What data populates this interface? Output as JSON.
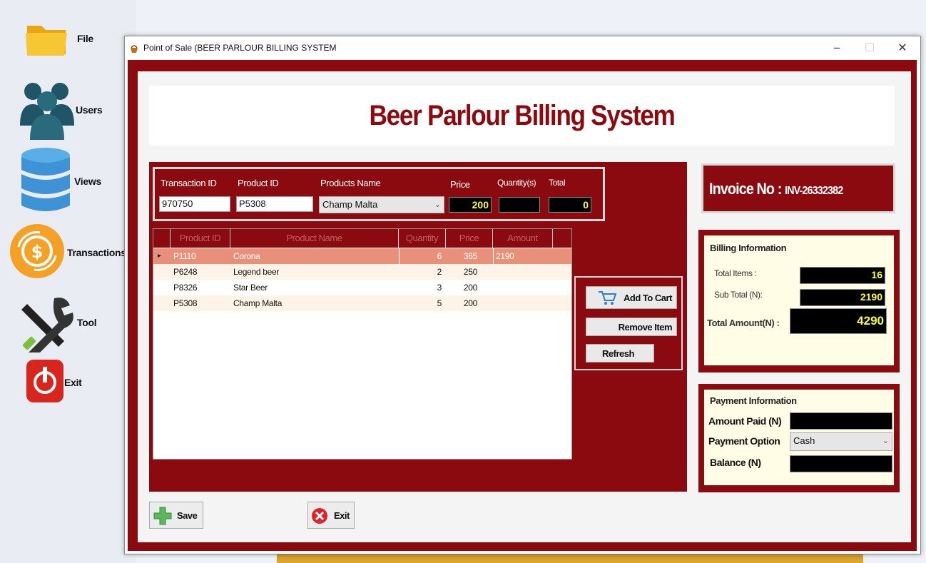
{
  "sidebar": {
    "items": [
      {
        "label": "File",
        "icon": "folder-icon"
      },
      {
        "label": "Users",
        "icon": "users-icon"
      },
      {
        "label": "Views",
        "icon": "database-icon"
      },
      {
        "label": "Transactions",
        "icon": "transactions-icon"
      },
      {
        "label": "Tool",
        "icon": "tools-icon"
      },
      {
        "label": "Exit",
        "icon": "power-icon"
      }
    ]
  },
  "window": {
    "title": "Point of Sale (BEER PARLOUR BILLING SYSTEM",
    "minimize": "‒",
    "maximize": "☐",
    "close": "✕"
  },
  "banner": {
    "title": "Beer Parlour Billing System"
  },
  "entry": {
    "transaction_id_label": "Transaction ID",
    "transaction_id_value": "970750",
    "product_id_label": "Product ID",
    "product_id_value": "P5308",
    "product_name_label": "Products Name",
    "product_name_value": "Champ Malta",
    "price_label": "Price",
    "price_value": "200",
    "quantity_label": "Quantity(s)",
    "quantity_value": "",
    "total_label": "Total",
    "total_value": "0"
  },
  "grid": {
    "columns": [
      "Product ID",
      "Product Name",
      "Quantity",
      "Price",
      "Amount"
    ],
    "rows": [
      {
        "selected": true,
        "product_id": "P1110",
        "product_name": "Corona",
        "quantity": "6",
        "price": "365",
        "amount": "2190"
      },
      {
        "selected": false,
        "product_id": "P6248",
        "product_name": "Legend beer",
        "quantity": "2",
        "price": "250",
        "amount": ""
      },
      {
        "selected": false,
        "product_id": "P8326",
        "product_name": "Star Beer",
        "quantity": "3",
        "price": "200",
        "amount": ""
      },
      {
        "selected": false,
        "product_id": "P5308",
        "product_name": "Champ Malta",
        "quantity": "5",
        "price": "200",
        "amount": ""
      }
    ],
    "row_marker": "▸"
  },
  "actions": {
    "add_to_cart": "Add To Cart",
    "remove_item": "Remove Item",
    "refresh": "Refresh"
  },
  "invoice": {
    "label": "Invoice No :",
    "number": "INV-26332382"
  },
  "billing": {
    "title": "Billing Information",
    "total_items_label": "Total Items :",
    "total_items_value": "16",
    "sub_total_label": "Sub Total (N):",
    "sub_total_value": "2190",
    "total_amount_label": "Total Amount(N) :",
    "total_amount_value": "4290"
  },
  "payment": {
    "title": "Payment Information",
    "amount_paid_label": "Amount Paid (N)",
    "amount_paid_value": "",
    "payment_option_label": "Payment Option",
    "payment_option_value": "Cash",
    "balance_label": "Balance (N)",
    "balance_value": ""
  },
  "footer": {
    "save": "Save",
    "exit": "Exit"
  },
  "colors": {
    "maroon": "#8b0a10",
    "highlight_row": "#e8907a",
    "alt_row": "#fdf0e0",
    "cream": "#fffde6",
    "yellow_text": "#ffff3a"
  }
}
